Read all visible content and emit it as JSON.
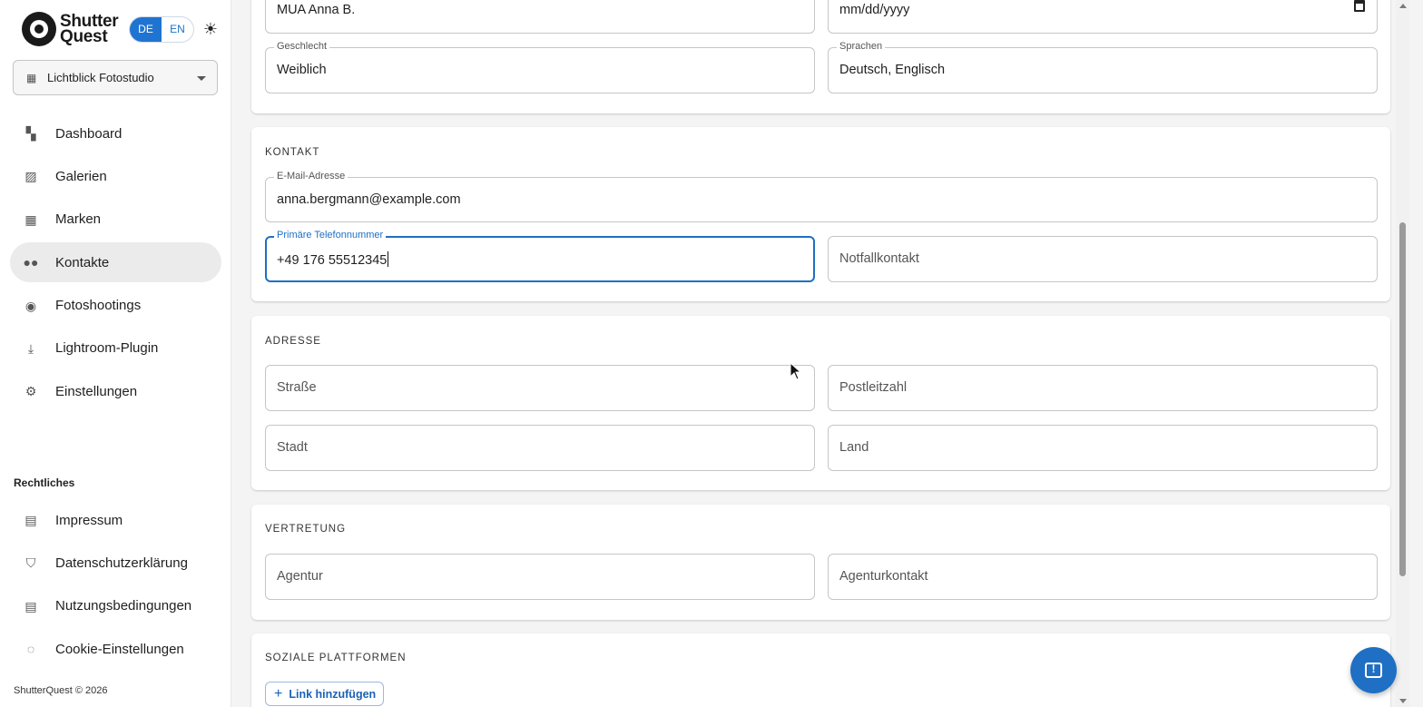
{
  "brand": {
    "line1": "Shutter",
    "line2": "Quest"
  },
  "language": {
    "de": "DE",
    "en": "EN",
    "active": "DE"
  },
  "studio": {
    "label": "Lichtblick Fotostudio"
  },
  "nav": {
    "items": [
      {
        "label": "Dashboard",
        "icon": "dashboard-icon"
      },
      {
        "label": "Galerien",
        "icon": "gallery-icon"
      },
      {
        "label": "Marken",
        "icon": "building-icon"
      },
      {
        "label": "Kontakte",
        "icon": "people-icon"
      },
      {
        "label": "Fotoshootings",
        "icon": "camera-icon"
      },
      {
        "label": "Lightroom-Plugin",
        "icon": "plugin-download-icon"
      },
      {
        "label": "Einstellungen",
        "icon": "gear-icon"
      }
    ],
    "active": "Kontakte"
  },
  "legal": {
    "heading": "Rechtliches",
    "items": [
      {
        "label": "Impressum",
        "icon": "document-icon"
      },
      {
        "label": "Datenschutzerklärung",
        "icon": "shield-icon"
      },
      {
        "label": "Nutzungsbedingungen",
        "icon": "document-icon"
      },
      {
        "label": "Cookie-Einstellungen",
        "icon": "cookie-icon"
      }
    ]
  },
  "footer": {
    "copyright": "ShutterQuest © 2026"
  },
  "personal": {
    "display_name": "MUA Anna B.",
    "birthdate_placeholder": "mm/dd/yyyy",
    "gender_label": "Geschlecht",
    "gender_value": "Weiblich",
    "languages_label": "Sprachen",
    "languages_value": "Deutsch, Englisch"
  },
  "contact": {
    "title": "KONTAKT",
    "email_label": "E-Mail-Adresse",
    "email_value": "anna.bergmann@example.com",
    "phone_label": "Primäre Telefonnummer",
    "phone_value": "+49 176 55512345",
    "emergency_placeholder": "Notfallkontakt"
  },
  "address": {
    "title": "ADRESSE",
    "street_placeholder": "Straße",
    "zip_placeholder": "Postleitzahl",
    "city_placeholder": "Stadt",
    "country_placeholder": "Land"
  },
  "representation": {
    "title": "VERTRETUNG",
    "agency_placeholder": "Agentur",
    "agency_contact_placeholder": "Agenturkontakt"
  },
  "social": {
    "title": "SOZIALE PLATTFORMEN",
    "add_link_label": "Link hinzufügen"
  },
  "colors": {
    "accent": "#1f6fc4",
    "active_nav_bg": "#ebebeb"
  }
}
